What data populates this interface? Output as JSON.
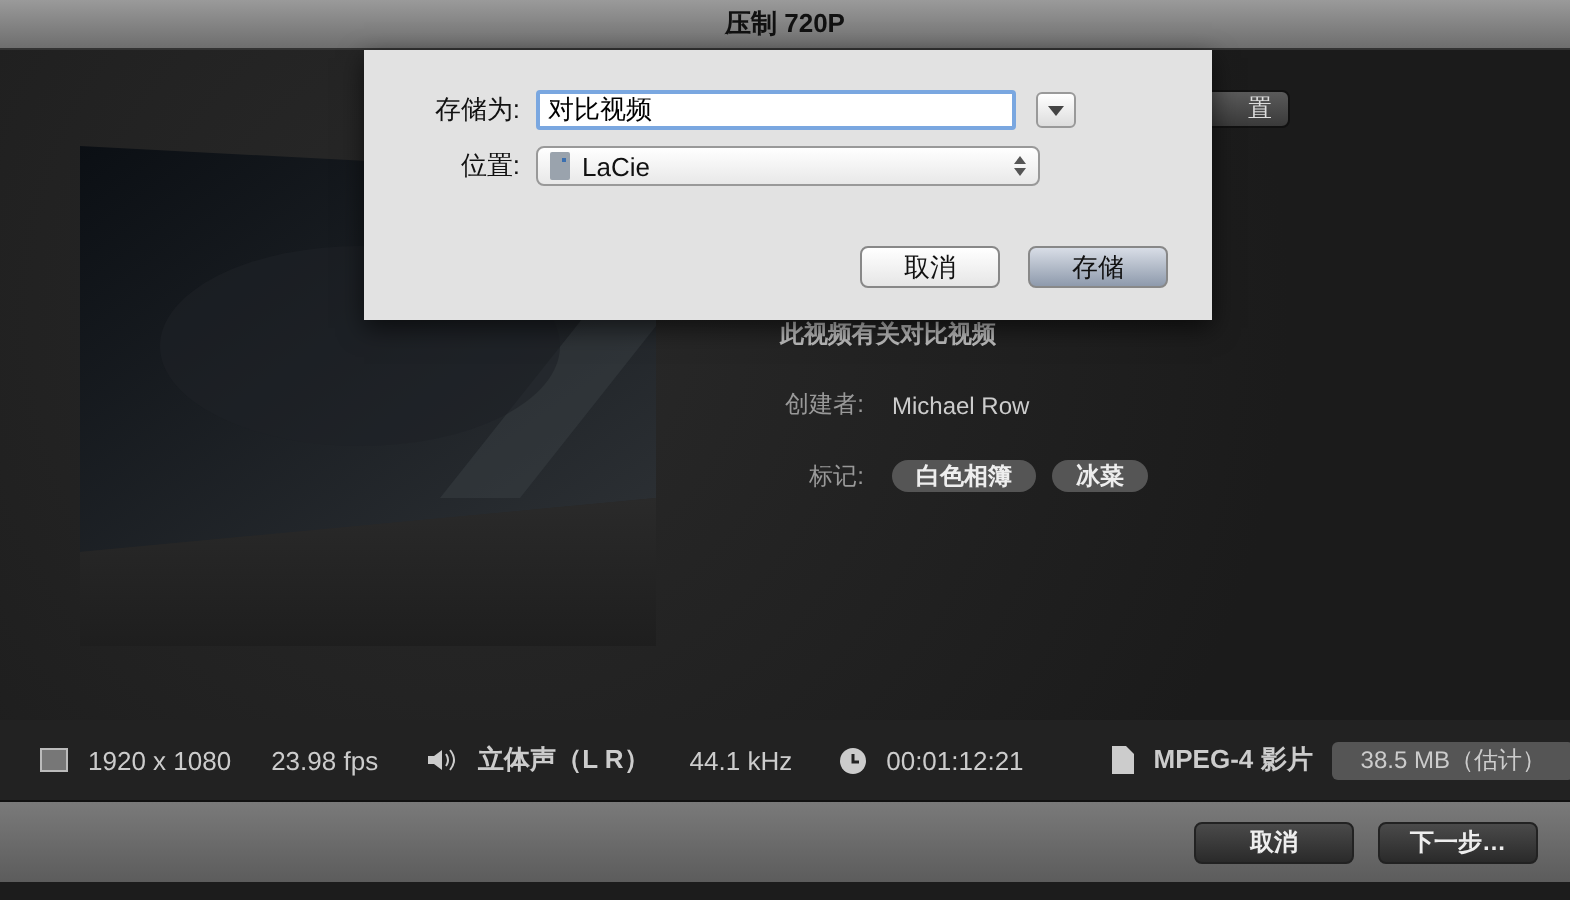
{
  "window": {
    "title": "压制 720P"
  },
  "location_button": {
    "label": "置"
  },
  "info": {
    "description": "此视频有关对比视频",
    "creator_label": "创建者:",
    "creator": "Michael Row",
    "tags_label": "标记:",
    "tags": [
      "白色相簿",
      "冰菜"
    ]
  },
  "status_bar": {
    "resolution": "1920 x 1080",
    "fps": "23.98 fps",
    "audio": "立体声（L R）",
    "sample_rate": "44.1 kHz",
    "duration": "00:01:12:21",
    "format": "MPEG-4 影片",
    "size": "38.5 MB（估计）"
  },
  "footer_buttons": [
    {
      "label": "取消",
      "default": false
    },
    {
      "label": "下一步…",
      "default": false
    }
  ],
  "save_dialog": {
    "save_as_label": "存储为:",
    "file_name": "对比视频",
    "location_label": "位置:",
    "location": "LaCie",
    "buttons": [
      {
        "label": "取消",
        "default": false
      },
      {
        "label": "存储",
        "default": true
      }
    ]
  }
}
